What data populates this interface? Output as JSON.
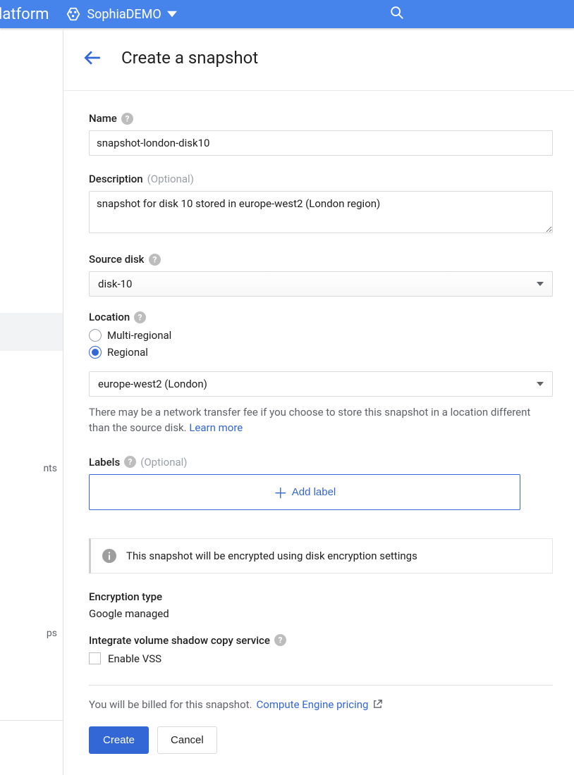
{
  "topbar": {
    "platform_fragment": "latform",
    "project_name": "SophiaDEMO"
  },
  "sidebar": {
    "item_nts": "nts",
    "item_ps": "ps"
  },
  "header": {
    "title": "Create a snapshot"
  },
  "form": {
    "name": {
      "label": "Name",
      "value": "snapshot-london-disk10"
    },
    "description": {
      "label": "Description",
      "optional": "(Optional)",
      "value": "snapshot for disk 10 stored in europe-west2 (London region)"
    },
    "source_disk": {
      "label": "Source disk",
      "value": "disk-10"
    },
    "location": {
      "label": "Location",
      "options": {
        "multi": "Multi-regional",
        "regional": "Regional"
      },
      "selected": "regional",
      "region_value": "europe-west2 (London)",
      "fee_text": "There may be a network transfer fee if you choose to store this snapshot in a location different than the source disk. ",
      "learn_more": "Learn more"
    },
    "labels": {
      "label": "Labels",
      "optional": "(Optional)",
      "add_button": "Add label"
    },
    "encryption_banner": "This snapshot will be encrypted using disk encryption settings",
    "encryption": {
      "title": "Encryption type",
      "value": "Google managed"
    },
    "vss": {
      "title": "Integrate volume shadow copy service",
      "checkbox_label": "Enable VSS",
      "checked": false
    },
    "billing": {
      "text": "You will be billed for this snapshot. ",
      "link": "Compute Engine pricing"
    },
    "buttons": {
      "create": "Create",
      "cancel": "Cancel"
    }
  }
}
